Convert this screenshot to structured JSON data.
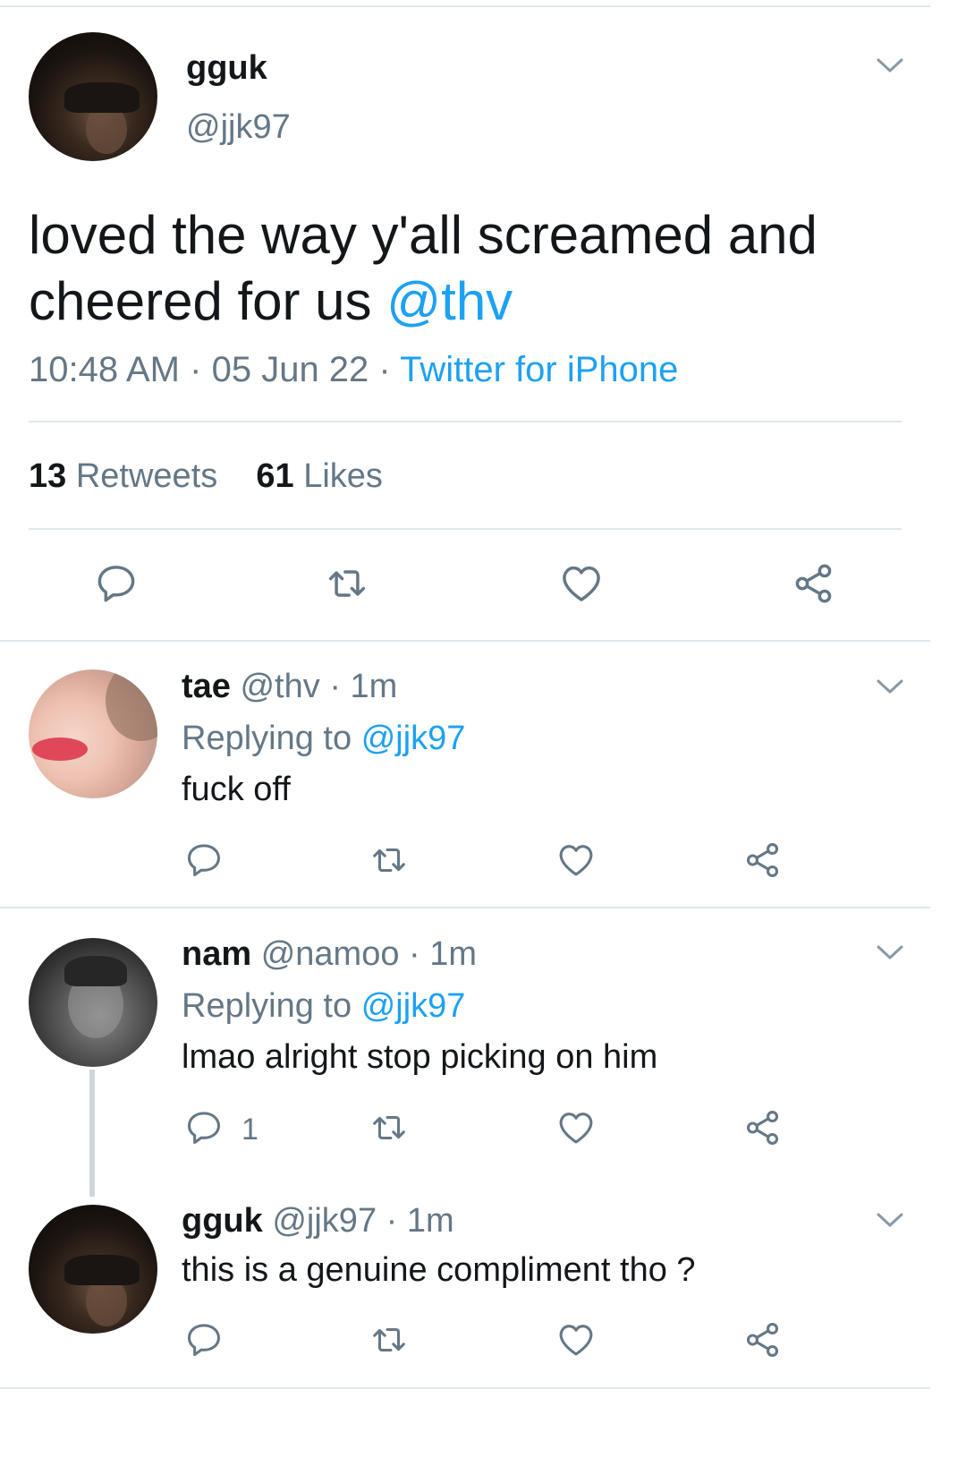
{
  "main_tweet": {
    "display_name": "gguk",
    "handle": "@jjk97",
    "text_line1": "loved the way y'all screamed and",
    "text_line2_prefix": "cheered for us ",
    "mention": "@thv",
    "time": "10:48 AM",
    "date": "05 Jun 22",
    "client": "Twitter for iPhone",
    "retweets_count": "13",
    "retweets_label": "Retweets",
    "likes_count": "61",
    "likes_label": "Likes"
  },
  "replies": [
    {
      "display_name": "tae",
      "handle": "@thv",
      "age": "1m",
      "replying_prefix": "Replying to",
      "replying_handle": "@jjk97",
      "text": "fuck off",
      "reply_count": ""
    },
    {
      "display_name": "nam",
      "handle": "@namoo",
      "age": "1m",
      "replying_prefix": "Replying to",
      "replying_handle": "@jjk97",
      "text": "lmao alright stop picking on him",
      "reply_count": "1"
    },
    {
      "display_name": "gguk",
      "handle": "@jjk97",
      "age": "1m",
      "text": "this is a genuine compliment tho ?",
      "reply_count": ""
    }
  ],
  "separator": "·",
  "icons": [
    "chevron-down-icon",
    "reply-icon",
    "retweet-icon",
    "like-icon",
    "share-icon"
  ],
  "colors": {
    "accent": "#1da1f2",
    "muted": "#657786",
    "divider": "#e1e8ed",
    "text": "#14171a"
  }
}
